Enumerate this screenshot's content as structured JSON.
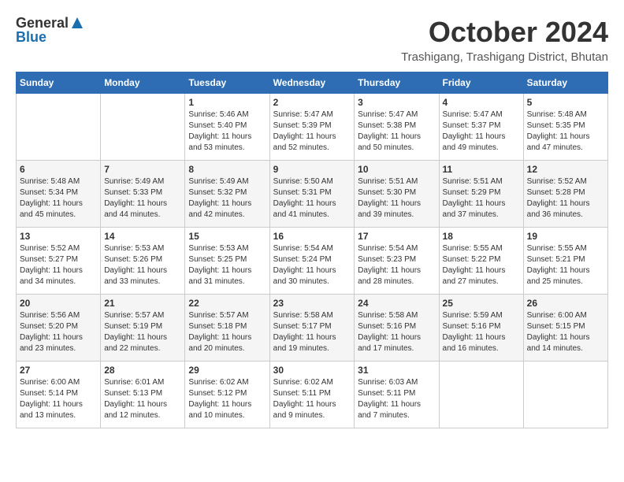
{
  "logo": {
    "general": "General",
    "blue": "Blue"
  },
  "header": {
    "month": "October 2024",
    "location": "Trashigang, Trashigang District, Bhutan"
  },
  "weekdays": [
    "Sunday",
    "Monday",
    "Tuesday",
    "Wednesday",
    "Thursday",
    "Friday",
    "Saturday"
  ],
  "weeks": [
    [
      {
        "day": "",
        "content": ""
      },
      {
        "day": "",
        "content": ""
      },
      {
        "day": "1",
        "content": "Sunrise: 5:46 AM\nSunset: 5:40 PM\nDaylight: 11 hours and 53 minutes."
      },
      {
        "day": "2",
        "content": "Sunrise: 5:47 AM\nSunset: 5:39 PM\nDaylight: 11 hours and 52 minutes."
      },
      {
        "day": "3",
        "content": "Sunrise: 5:47 AM\nSunset: 5:38 PM\nDaylight: 11 hours and 50 minutes."
      },
      {
        "day": "4",
        "content": "Sunrise: 5:47 AM\nSunset: 5:37 PM\nDaylight: 11 hours and 49 minutes."
      },
      {
        "day": "5",
        "content": "Sunrise: 5:48 AM\nSunset: 5:35 PM\nDaylight: 11 hours and 47 minutes."
      }
    ],
    [
      {
        "day": "6",
        "content": "Sunrise: 5:48 AM\nSunset: 5:34 PM\nDaylight: 11 hours and 45 minutes."
      },
      {
        "day": "7",
        "content": "Sunrise: 5:49 AM\nSunset: 5:33 PM\nDaylight: 11 hours and 44 minutes."
      },
      {
        "day": "8",
        "content": "Sunrise: 5:49 AM\nSunset: 5:32 PM\nDaylight: 11 hours and 42 minutes."
      },
      {
        "day": "9",
        "content": "Sunrise: 5:50 AM\nSunset: 5:31 PM\nDaylight: 11 hours and 41 minutes."
      },
      {
        "day": "10",
        "content": "Sunrise: 5:51 AM\nSunset: 5:30 PM\nDaylight: 11 hours and 39 minutes."
      },
      {
        "day": "11",
        "content": "Sunrise: 5:51 AM\nSunset: 5:29 PM\nDaylight: 11 hours and 37 minutes."
      },
      {
        "day": "12",
        "content": "Sunrise: 5:52 AM\nSunset: 5:28 PM\nDaylight: 11 hours and 36 minutes."
      }
    ],
    [
      {
        "day": "13",
        "content": "Sunrise: 5:52 AM\nSunset: 5:27 PM\nDaylight: 11 hours and 34 minutes."
      },
      {
        "day": "14",
        "content": "Sunrise: 5:53 AM\nSunset: 5:26 PM\nDaylight: 11 hours and 33 minutes."
      },
      {
        "day": "15",
        "content": "Sunrise: 5:53 AM\nSunset: 5:25 PM\nDaylight: 11 hours and 31 minutes."
      },
      {
        "day": "16",
        "content": "Sunrise: 5:54 AM\nSunset: 5:24 PM\nDaylight: 11 hours and 30 minutes."
      },
      {
        "day": "17",
        "content": "Sunrise: 5:54 AM\nSunset: 5:23 PM\nDaylight: 11 hours and 28 minutes."
      },
      {
        "day": "18",
        "content": "Sunrise: 5:55 AM\nSunset: 5:22 PM\nDaylight: 11 hours and 27 minutes."
      },
      {
        "day": "19",
        "content": "Sunrise: 5:55 AM\nSunset: 5:21 PM\nDaylight: 11 hours and 25 minutes."
      }
    ],
    [
      {
        "day": "20",
        "content": "Sunrise: 5:56 AM\nSunset: 5:20 PM\nDaylight: 11 hours and 23 minutes."
      },
      {
        "day": "21",
        "content": "Sunrise: 5:57 AM\nSunset: 5:19 PM\nDaylight: 11 hours and 22 minutes."
      },
      {
        "day": "22",
        "content": "Sunrise: 5:57 AM\nSunset: 5:18 PM\nDaylight: 11 hours and 20 minutes."
      },
      {
        "day": "23",
        "content": "Sunrise: 5:58 AM\nSunset: 5:17 PM\nDaylight: 11 hours and 19 minutes."
      },
      {
        "day": "24",
        "content": "Sunrise: 5:58 AM\nSunset: 5:16 PM\nDaylight: 11 hours and 17 minutes."
      },
      {
        "day": "25",
        "content": "Sunrise: 5:59 AM\nSunset: 5:16 PM\nDaylight: 11 hours and 16 minutes."
      },
      {
        "day": "26",
        "content": "Sunrise: 6:00 AM\nSunset: 5:15 PM\nDaylight: 11 hours and 14 minutes."
      }
    ],
    [
      {
        "day": "27",
        "content": "Sunrise: 6:00 AM\nSunset: 5:14 PM\nDaylight: 11 hours and 13 minutes."
      },
      {
        "day": "28",
        "content": "Sunrise: 6:01 AM\nSunset: 5:13 PM\nDaylight: 11 hours and 12 minutes."
      },
      {
        "day": "29",
        "content": "Sunrise: 6:02 AM\nSunset: 5:12 PM\nDaylight: 11 hours and 10 minutes."
      },
      {
        "day": "30",
        "content": "Sunrise: 6:02 AM\nSunset: 5:11 PM\nDaylight: 11 hours and 9 minutes."
      },
      {
        "day": "31",
        "content": "Sunrise: 6:03 AM\nSunset: 5:11 PM\nDaylight: 11 hours and 7 minutes."
      },
      {
        "day": "",
        "content": ""
      },
      {
        "day": "",
        "content": ""
      }
    ]
  ]
}
